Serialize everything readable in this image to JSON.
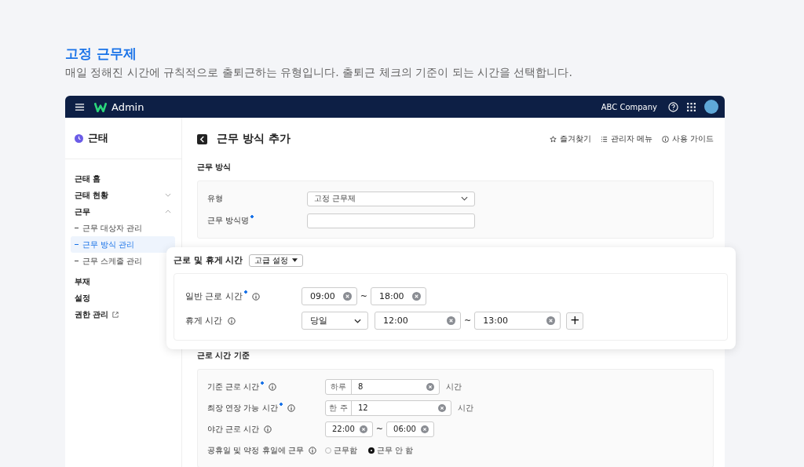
{
  "page": {
    "title": "고정 근무제",
    "description": "매일 정해진 시간에 규칙적으로 출퇴근하는 유형입니다. 출퇴근 체크의 기준이 되는 시간을 선택합니다."
  },
  "header": {
    "app_name": "Admin",
    "company": "ABC Company"
  },
  "sidebar": {
    "title": "근태",
    "items": [
      {
        "label": "근태 홈",
        "kind": "link",
        "selected": false
      },
      {
        "label": "근태 현황",
        "kind": "group",
        "selected": false,
        "expanded": false
      },
      {
        "label": "근무",
        "kind": "group",
        "selected": false,
        "expanded": true,
        "children": [
          {
            "label": "근무 대상자 관리",
            "selected": false
          },
          {
            "label": "근무 방식 관리",
            "selected": true
          },
          {
            "label": "근무 스케줄 관리",
            "selected": false
          }
        ]
      },
      {
        "label": "부재",
        "kind": "link",
        "selected": false
      },
      {
        "label": "설정",
        "kind": "link",
        "selected": false
      },
      {
        "label": "권한 관리",
        "kind": "external",
        "selected": false
      }
    ]
  },
  "content": {
    "title": "근무 방식 추가",
    "actions": [
      {
        "label": "즐겨찾기",
        "kind": "star"
      },
      {
        "label": "관리자 메뉴",
        "kind": "list"
      },
      {
        "label": "사용 가이드",
        "kind": "info"
      }
    ],
    "work_type": {
      "heading": "근무 방식",
      "fields": [
        {
          "label": "유형",
          "required": false,
          "kind": "select",
          "value": "고정 근무제"
        },
        {
          "label": "근무 방식명",
          "required": true,
          "kind": "text"
        }
      ]
    },
    "work_break": {
      "heading": "근로 및 휴게 시간",
      "advanced_button": "고급 설정",
      "rows": [
        {
          "label": "일반 근로 시간",
          "required": true,
          "kind": "range",
          "from": "09:00",
          "separator": "~",
          "to": "18:00"
        },
        {
          "label": "휴게 시간",
          "required": false,
          "kind": "break",
          "day": "당일",
          "from": "12:00",
          "separator": "~",
          "to": "13:00",
          "add": "+"
        }
      ]
    },
    "criteria": {
      "heading": "근로 시간 기준",
      "rows": [
        {
          "label": "기준 근로 시간",
          "required": true,
          "kind": "unit",
          "prefix": "하루",
          "value": "8",
          "suffix": "시간"
        },
        {
          "label": "최장 연장 가능 시간",
          "required": true,
          "kind": "unit",
          "prefix": "한 주",
          "value": "12",
          "suffix": "시간"
        },
        {
          "label": "야간 근로 시간",
          "required": false,
          "kind": "range",
          "from": "22:00",
          "separator": "~",
          "to": "06:00"
        },
        {
          "label": "공휴일 및 약정 휴일에 근무",
          "required": false,
          "kind": "radio",
          "options": [
            {
              "label": "근무함",
              "selected": false
            },
            {
              "label": "근무 안 함",
              "selected": true
            }
          ]
        }
      ]
    }
  }
}
